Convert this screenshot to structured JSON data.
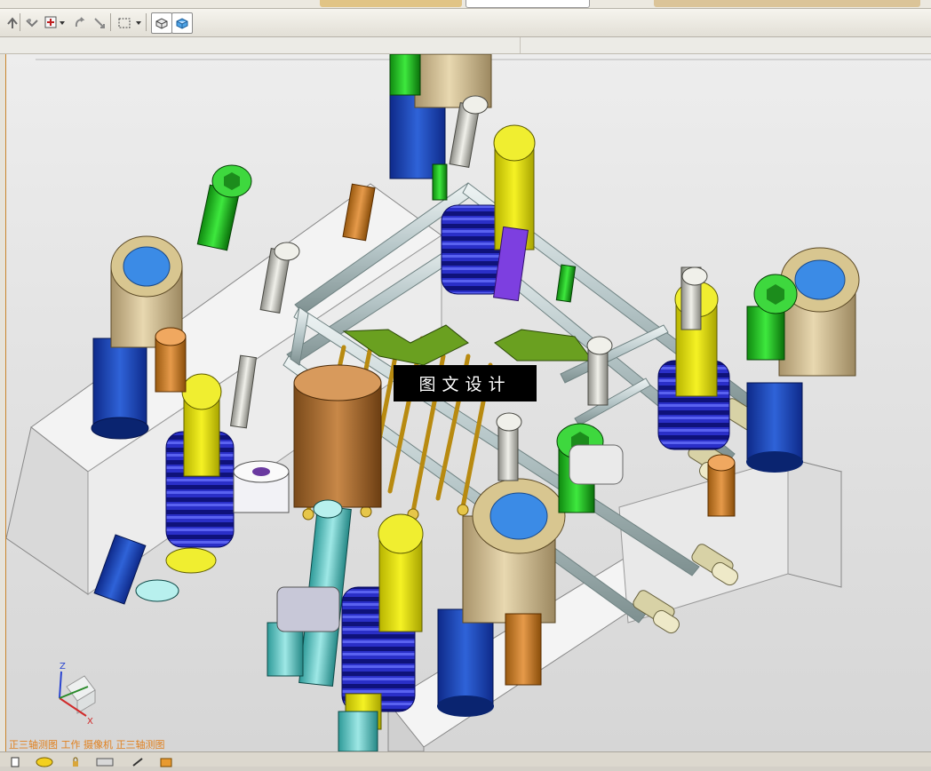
{
  "watermark": {
    "text": "图文设计"
  },
  "view_label": {
    "text": "正三轴测图 工作 摄像机 正三轴测图"
  },
  "triad": {
    "x_label": "X",
    "z_label": "Z"
  },
  "toolbar": {
    "icons": [
      "pan-icon",
      "snap-icon",
      "rotate-icon",
      "fit-view-icon",
      "box-select-icon",
      "shaded-view-icon",
      "solid-view-icon"
    ]
  },
  "colors": {
    "background": "#d4d0c8",
    "viewport_bg": "#e9e9e9",
    "view_label": "#e0801e",
    "watermark_bg": "#000000",
    "watermark_fg": "#ffffff"
  }
}
